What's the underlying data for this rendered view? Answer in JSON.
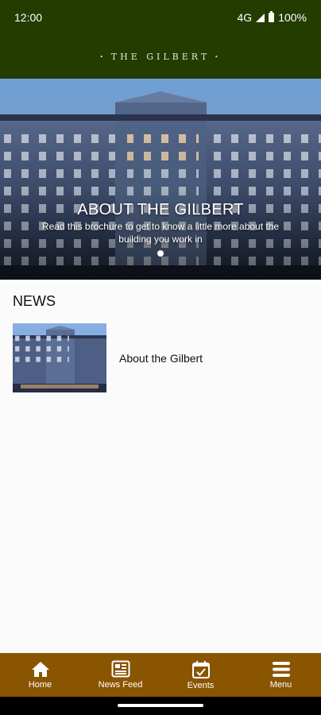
{
  "status_bar": {
    "time": "12:00",
    "network": "4G",
    "battery": "100%"
  },
  "header": {
    "logo_text": "THE GILBERT"
  },
  "hero": {
    "title": "ABOUT THE GILBERT",
    "subtitle": "Read this brochure to get to know a little more about the building you work in",
    "slide_count": 1,
    "active_slide": 1
  },
  "news": {
    "heading": "NEWS",
    "items": [
      {
        "title": "About the Gilbert",
        "image": "building-facade"
      }
    ]
  },
  "bottom_nav": {
    "items": [
      {
        "label": "Home",
        "icon": "home-icon"
      },
      {
        "label": "News Feed",
        "icon": "newspaper-icon"
      },
      {
        "label": "Events",
        "icon": "calendar-icon"
      },
      {
        "label": "Menu",
        "icon": "hamburger-menu-icon"
      }
    ]
  },
  "colors": {
    "header_bg": "#233c00",
    "nav_bg": "#8a5500",
    "page_bg": "#fbfbfb"
  }
}
